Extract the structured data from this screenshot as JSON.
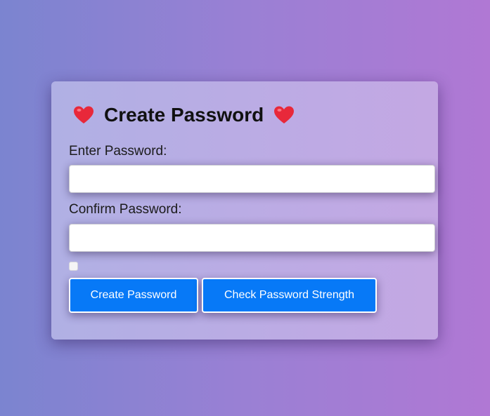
{
  "form": {
    "title": "Create Password",
    "title_icon": "heart-icon",
    "password_label": "Enter Password:",
    "password_value": "",
    "password_placeholder": "",
    "confirm_label": "Confirm Password:",
    "confirm_value": "",
    "confirm_placeholder": "",
    "show_password_checked": false,
    "create_button_label": "Create Password",
    "strength_button_label": "Check Password Strength"
  },
  "colors": {
    "background_start": "#7b84d0",
    "background_end": "#b078d4",
    "heart": "#e8283a",
    "button": "#0779f7",
    "button_text": "#ffffff"
  }
}
